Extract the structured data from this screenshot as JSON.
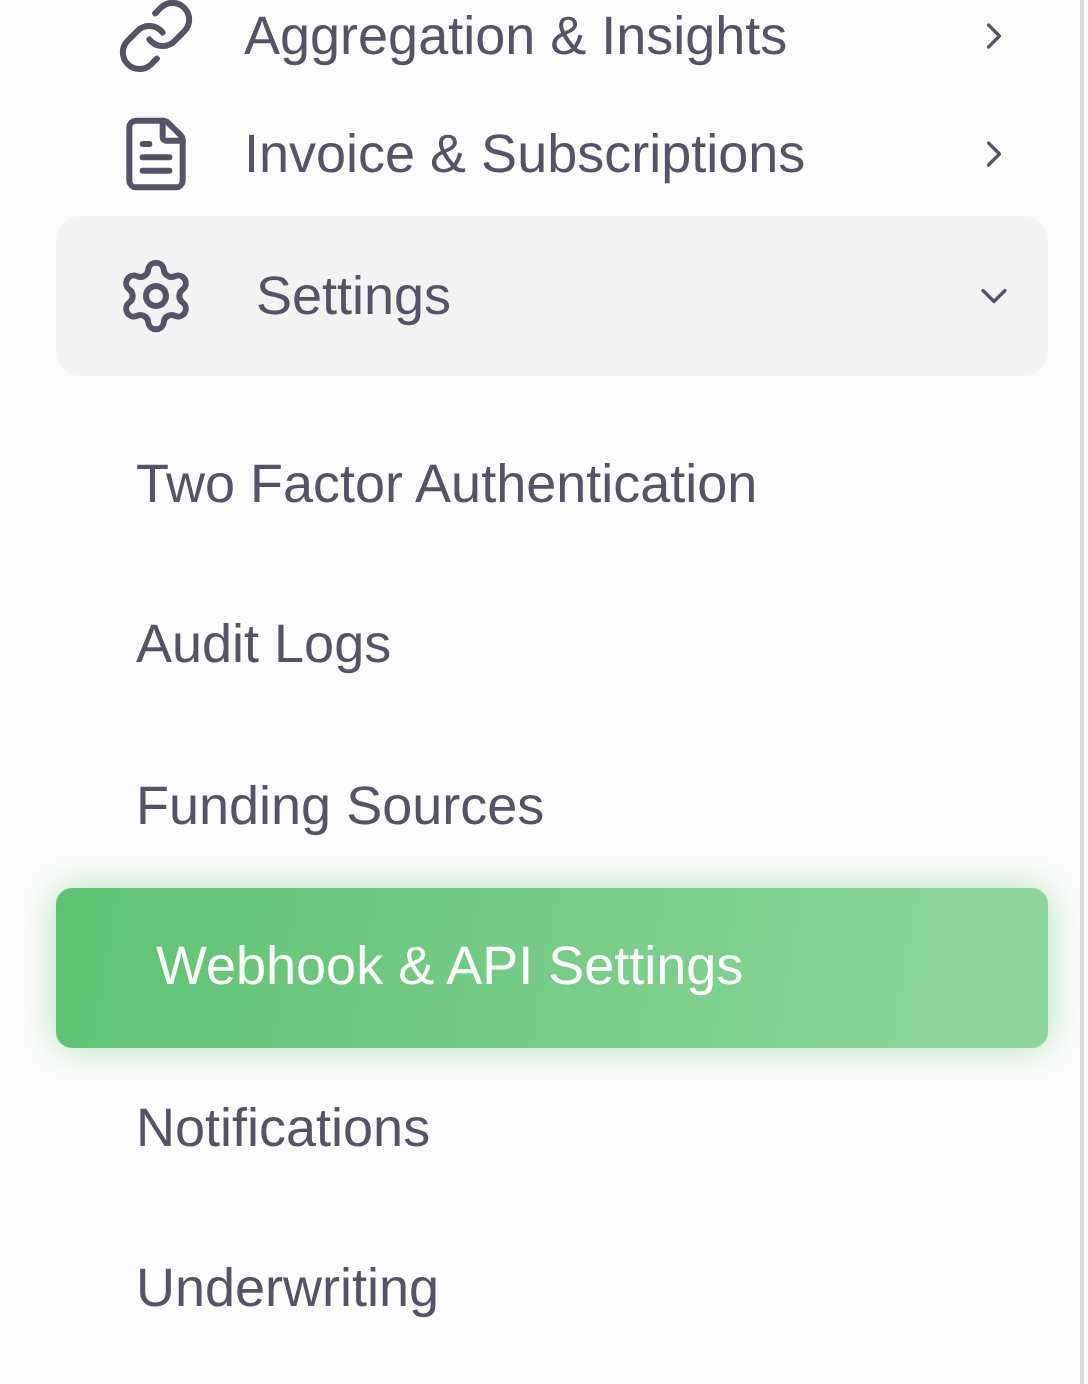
{
  "nav_items": [
    {
      "label": "Aggregation & Insights",
      "expanded": false,
      "selected": false
    },
    {
      "label": "Invoice & Subscriptions",
      "expanded": false,
      "selected": false
    },
    {
      "label": "Settings",
      "expanded": true,
      "selected": true,
      "children": [
        {
          "label": "Two Factor Authentication",
          "selected": false
        },
        {
          "label": "Audit Logs",
          "selected": false
        },
        {
          "label": "Funding Sources",
          "selected": false
        },
        {
          "label": "Webhook & API Settings",
          "selected": true
        },
        {
          "label": "Notifications",
          "selected": false
        },
        {
          "label": "Underwriting",
          "selected": false
        }
      ]
    }
  ]
}
